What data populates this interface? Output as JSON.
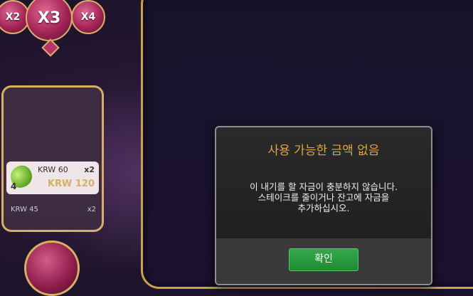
{
  "multipliers": {
    "left": "X2",
    "active": "X3",
    "right": "X4"
  },
  "win_panel": {
    "items": [
      {
        "currency_label": "KRW 60",
        "multiplier": "x2",
        "amount": "KRW 120",
        "count": "4",
        "symbol_icon": "green-bean-icon"
      },
      {
        "currency_label": "KRW 45",
        "multiplier": "x2"
      }
    ]
  },
  "dialog": {
    "title": "사용 가능한 금액 없음",
    "message_line1": "이 내기를 할 자금이 충분하지 않습니다.",
    "message_line2": "스테이크를 줄이거나 잔고에 자금을",
    "message_line3": "추가하십시오.",
    "ok_label": "확인"
  },
  "colors": {
    "title_accent": "#e0a63a",
    "button_green": "#2a9a3e",
    "gold_frame": "#d8b063"
  }
}
